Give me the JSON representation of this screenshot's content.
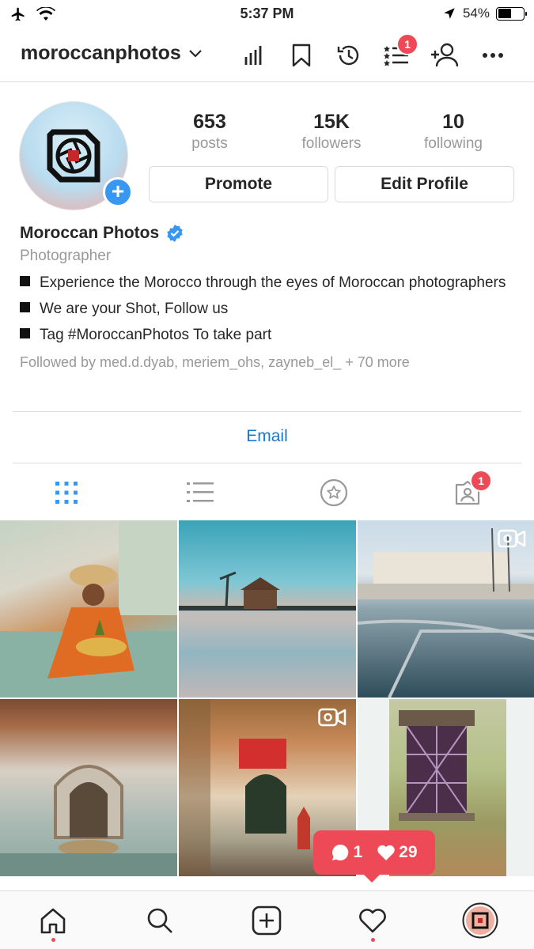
{
  "status": {
    "time": "5:37 PM",
    "battery": "54%",
    "battery_level": 0.54
  },
  "header": {
    "username": "moroccanphotos",
    "notification_count": "1"
  },
  "profile": {
    "stats": [
      {
        "value": "653",
        "label": "posts"
      },
      {
        "value": "15K",
        "label": "followers"
      },
      {
        "value": "10",
        "label": "following"
      }
    ],
    "promote_label": "Promote",
    "edit_label": "Edit Profile",
    "display_name": "Moroccan Photos",
    "category": "Photographer",
    "bio": [
      "Experience the Morocco through the eyes of Moroccan photographers",
      "We are your Shot, Follow us",
      "Tag #MoroccanPhotos To take part"
    ],
    "followed_by": "Followed by med.d.dyab, meriem_ohs, zayneb_el_ + 70 more",
    "email_label": "Email"
  },
  "tabs": {
    "tagged_badge": "1"
  },
  "notification": {
    "comments": "1",
    "likes": "29"
  },
  "colors": {
    "accent": "#3897f0",
    "badge": "#ed4956",
    "link": "#1b78c8"
  }
}
